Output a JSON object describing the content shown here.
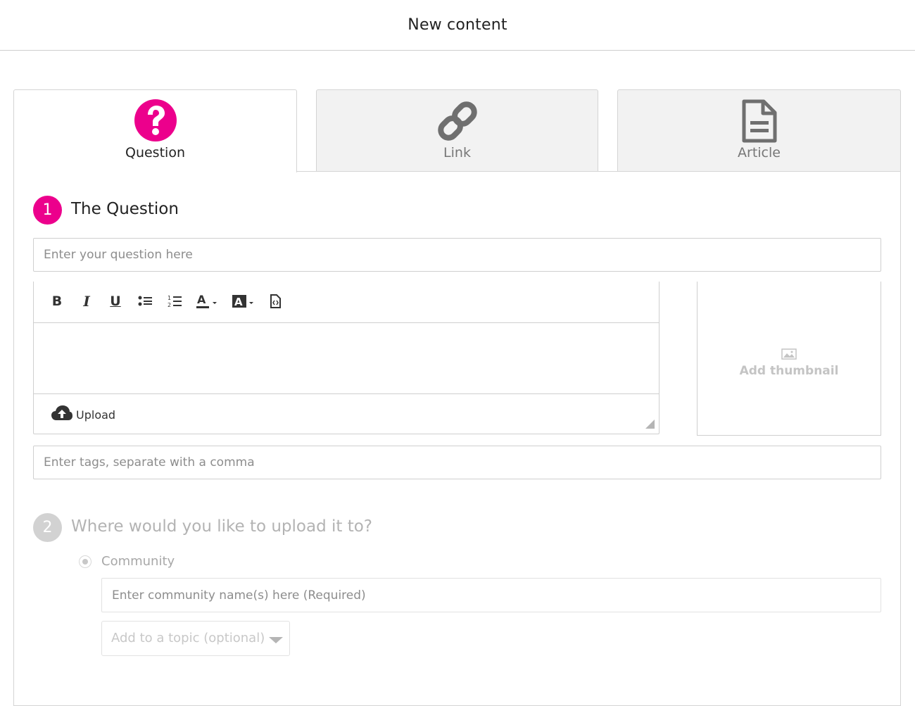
{
  "header": {
    "title": "New content"
  },
  "tabs": [
    {
      "label": "Question",
      "icon": "question-circle-icon",
      "active": true
    },
    {
      "label": "Link",
      "icon": "link-icon",
      "active": false
    },
    {
      "label": "Article",
      "icon": "document-icon",
      "active": false
    }
  ],
  "colors": {
    "accent": "#ec008c",
    "muted_step": "#d2d2d2"
  },
  "step1": {
    "number": "1",
    "title": "The Question",
    "question_placeholder": "Enter your question here",
    "toolbar": {
      "bold": "B",
      "italic": "I",
      "underline": "U",
      "buttons": [
        "bold-icon",
        "italic-icon",
        "underline-icon",
        "bullet-list-icon",
        "numbered-list-icon",
        "text-color-icon",
        "highlight-color-icon",
        "source-code-icon"
      ]
    },
    "upload_label": "Upload",
    "thumbnail_label": "Add thumbnail",
    "tags_placeholder": "Enter tags, separate with a comma"
  },
  "step2": {
    "number": "2",
    "title": "Where would you like to upload it to?",
    "option_label": "Community",
    "community_placeholder": "Enter community name(s) here (Required)",
    "topic_label": "Add to a topic (optional)"
  }
}
